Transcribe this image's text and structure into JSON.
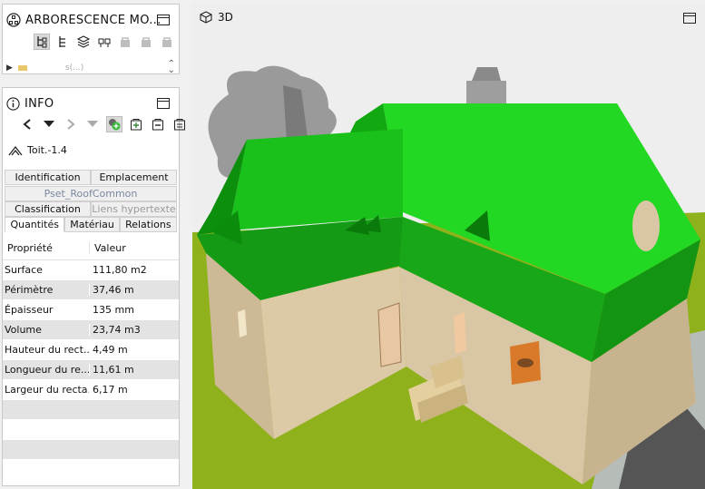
{
  "tree_panel": {
    "title": "ARBORESCENCE MO...",
    "tree_item_text": "s(...)"
  },
  "info_panel": {
    "title": "INFO",
    "object_name": "Toit.-1.4",
    "tabs_row1": [
      "Identification",
      "Emplacement"
    ],
    "tabs_row2": [
      "Pset_RoofCommon"
    ],
    "tabs_row3": [
      "Classification",
      "Liens hypertexte"
    ],
    "tabs_row4": [
      "Quantités",
      "Matériau",
      "Relations"
    ],
    "active_tab": "Quantités",
    "table": {
      "headers": [
        "Propriété",
        "Valeur"
      ],
      "rows": [
        {
          "k": "Surface",
          "v": "111,80 m2"
        },
        {
          "k": "Périmètre",
          "v": "37,46 m"
        },
        {
          "k": "Épaisseur",
          "v": "135 mm"
        },
        {
          "k": "Volume",
          "v": "23,74 m3"
        },
        {
          "k": "Hauteur du rect...",
          "v": "4,49 m"
        },
        {
          "k": "Longueur du re...",
          "v": "11,61 m"
        },
        {
          "k": "Largeur du recta...",
          "v": "6,17 m"
        }
      ]
    }
  },
  "viewport": {
    "title": "3D",
    "roof_color": "#1fd11f",
    "wall_color": "#d8c6a4",
    "ground_color": "#8fb21c"
  }
}
